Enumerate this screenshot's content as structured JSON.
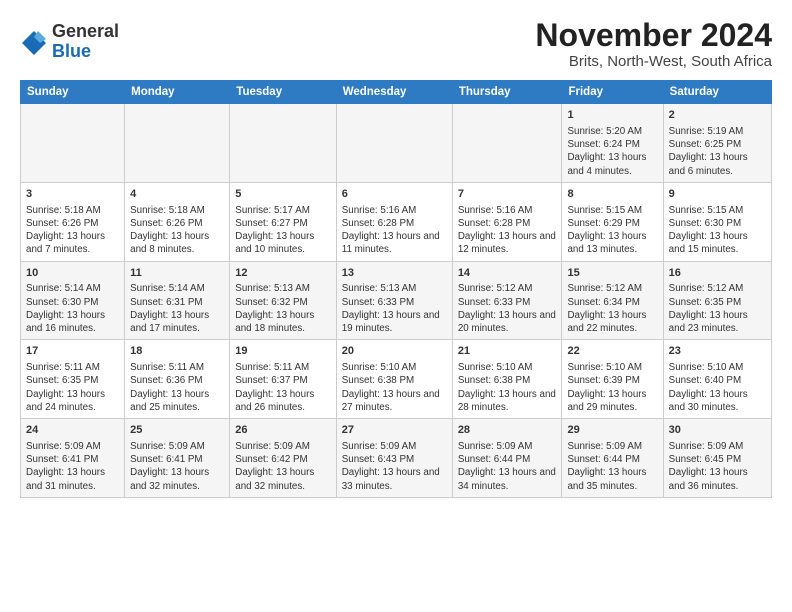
{
  "header": {
    "logo_general": "General",
    "logo_blue": "Blue",
    "title": "November 2024",
    "subtitle": "Brits, North-West, South Africa"
  },
  "days_of_week": [
    "Sunday",
    "Monday",
    "Tuesday",
    "Wednesday",
    "Thursday",
    "Friday",
    "Saturday"
  ],
  "weeks": [
    [
      {
        "day": "",
        "info": ""
      },
      {
        "day": "",
        "info": ""
      },
      {
        "day": "",
        "info": ""
      },
      {
        "day": "",
        "info": ""
      },
      {
        "day": "",
        "info": ""
      },
      {
        "day": "1",
        "info": "Sunrise: 5:20 AM\nSunset: 6:24 PM\nDaylight: 13 hours and 4 minutes."
      },
      {
        "day": "2",
        "info": "Sunrise: 5:19 AM\nSunset: 6:25 PM\nDaylight: 13 hours and 6 minutes."
      }
    ],
    [
      {
        "day": "3",
        "info": "Sunrise: 5:18 AM\nSunset: 6:26 PM\nDaylight: 13 hours and 7 minutes."
      },
      {
        "day": "4",
        "info": "Sunrise: 5:18 AM\nSunset: 6:26 PM\nDaylight: 13 hours and 8 minutes."
      },
      {
        "day": "5",
        "info": "Sunrise: 5:17 AM\nSunset: 6:27 PM\nDaylight: 13 hours and 10 minutes."
      },
      {
        "day": "6",
        "info": "Sunrise: 5:16 AM\nSunset: 6:28 PM\nDaylight: 13 hours and 11 minutes."
      },
      {
        "day": "7",
        "info": "Sunrise: 5:16 AM\nSunset: 6:28 PM\nDaylight: 13 hours and 12 minutes."
      },
      {
        "day": "8",
        "info": "Sunrise: 5:15 AM\nSunset: 6:29 PM\nDaylight: 13 hours and 13 minutes."
      },
      {
        "day": "9",
        "info": "Sunrise: 5:15 AM\nSunset: 6:30 PM\nDaylight: 13 hours and 15 minutes."
      }
    ],
    [
      {
        "day": "10",
        "info": "Sunrise: 5:14 AM\nSunset: 6:30 PM\nDaylight: 13 hours and 16 minutes."
      },
      {
        "day": "11",
        "info": "Sunrise: 5:14 AM\nSunset: 6:31 PM\nDaylight: 13 hours and 17 minutes."
      },
      {
        "day": "12",
        "info": "Sunrise: 5:13 AM\nSunset: 6:32 PM\nDaylight: 13 hours and 18 minutes."
      },
      {
        "day": "13",
        "info": "Sunrise: 5:13 AM\nSunset: 6:33 PM\nDaylight: 13 hours and 19 minutes."
      },
      {
        "day": "14",
        "info": "Sunrise: 5:12 AM\nSunset: 6:33 PM\nDaylight: 13 hours and 20 minutes."
      },
      {
        "day": "15",
        "info": "Sunrise: 5:12 AM\nSunset: 6:34 PM\nDaylight: 13 hours and 22 minutes."
      },
      {
        "day": "16",
        "info": "Sunrise: 5:12 AM\nSunset: 6:35 PM\nDaylight: 13 hours and 23 minutes."
      }
    ],
    [
      {
        "day": "17",
        "info": "Sunrise: 5:11 AM\nSunset: 6:35 PM\nDaylight: 13 hours and 24 minutes."
      },
      {
        "day": "18",
        "info": "Sunrise: 5:11 AM\nSunset: 6:36 PM\nDaylight: 13 hours and 25 minutes."
      },
      {
        "day": "19",
        "info": "Sunrise: 5:11 AM\nSunset: 6:37 PM\nDaylight: 13 hours and 26 minutes."
      },
      {
        "day": "20",
        "info": "Sunrise: 5:10 AM\nSunset: 6:38 PM\nDaylight: 13 hours and 27 minutes."
      },
      {
        "day": "21",
        "info": "Sunrise: 5:10 AM\nSunset: 6:38 PM\nDaylight: 13 hours and 28 minutes."
      },
      {
        "day": "22",
        "info": "Sunrise: 5:10 AM\nSunset: 6:39 PM\nDaylight: 13 hours and 29 minutes."
      },
      {
        "day": "23",
        "info": "Sunrise: 5:10 AM\nSunset: 6:40 PM\nDaylight: 13 hours and 30 minutes."
      }
    ],
    [
      {
        "day": "24",
        "info": "Sunrise: 5:09 AM\nSunset: 6:41 PM\nDaylight: 13 hours and 31 minutes."
      },
      {
        "day": "25",
        "info": "Sunrise: 5:09 AM\nSunset: 6:41 PM\nDaylight: 13 hours and 32 minutes."
      },
      {
        "day": "26",
        "info": "Sunrise: 5:09 AM\nSunset: 6:42 PM\nDaylight: 13 hours and 32 minutes."
      },
      {
        "day": "27",
        "info": "Sunrise: 5:09 AM\nSunset: 6:43 PM\nDaylight: 13 hours and 33 minutes."
      },
      {
        "day": "28",
        "info": "Sunrise: 5:09 AM\nSunset: 6:44 PM\nDaylight: 13 hours and 34 minutes."
      },
      {
        "day": "29",
        "info": "Sunrise: 5:09 AM\nSunset: 6:44 PM\nDaylight: 13 hours and 35 minutes."
      },
      {
        "day": "30",
        "info": "Sunrise: 5:09 AM\nSunset: 6:45 PM\nDaylight: 13 hours and 36 minutes."
      }
    ]
  ]
}
